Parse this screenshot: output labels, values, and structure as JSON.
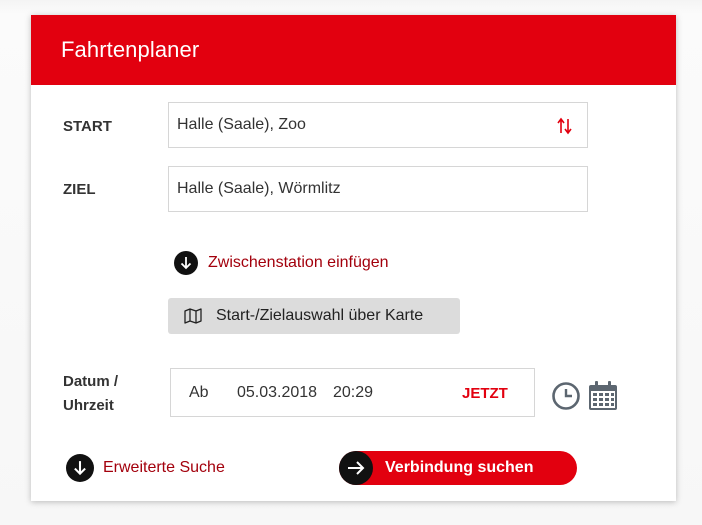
{
  "header": {
    "title": "Fahrtenplaner"
  },
  "start": {
    "label": "START",
    "value": "Halle (Saale), Zoo"
  },
  "ziel": {
    "label": "ZIEL",
    "value": "Halle (Saale), Wörmlitz"
  },
  "via_link": "Zwischenstation einfügen",
  "map_button": "Start-/Zielauswahl über Karte",
  "datetime": {
    "label_line1": "Datum /",
    "label_line2": "Uhrzeit",
    "mode": "Ab",
    "date": "05.03.2018",
    "time": "20:29",
    "now_label": "JETZT"
  },
  "advanced_link": "Erweiterte Suche",
  "search_button": "Verbindung suchen",
  "colors": {
    "brand_red": "#e2000f",
    "link_red": "#a3000c"
  },
  "icons": [
    "swap-icon",
    "arrow-down-icon",
    "map-icon",
    "clock-icon",
    "calendar-icon",
    "arrow-right-icon"
  ]
}
